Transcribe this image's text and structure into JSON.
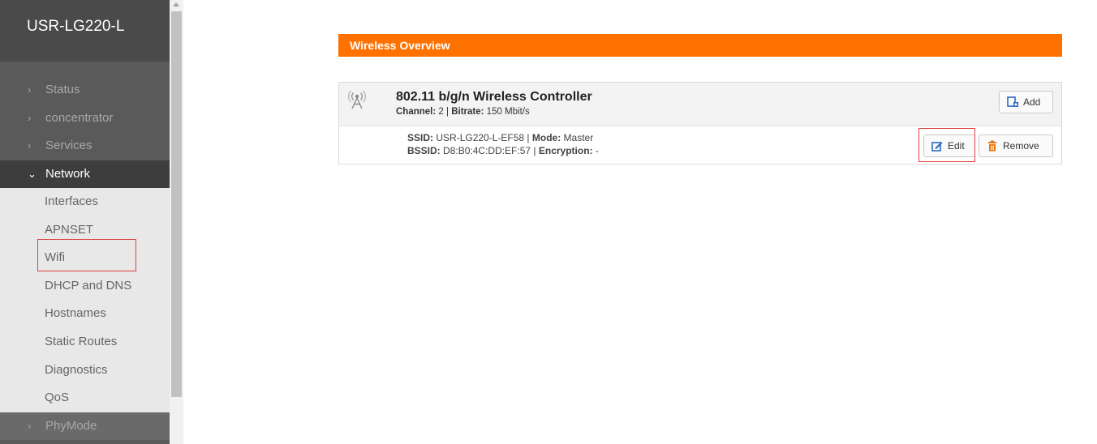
{
  "app": {
    "title": "USR-LG220-L"
  },
  "sidebar": {
    "menu": [
      {
        "label": "Status"
      },
      {
        "label": "concentrator"
      },
      {
        "label": "Services"
      }
    ],
    "network": {
      "label": "Network",
      "submenu": [
        {
          "label": "Interfaces"
        },
        {
          "label": "APNSET"
        },
        {
          "label": "Wifi"
        },
        {
          "label": "DHCP and DNS"
        },
        {
          "label": "Hostnames"
        },
        {
          "label": "Static Routes"
        },
        {
          "label": "Diagnostics"
        },
        {
          "label": "QoS"
        }
      ]
    },
    "phymode": {
      "label": "PhyMode"
    }
  },
  "main": {
    "section_title": "Wireless Overview",
    "controller": {
      "title": "802.11 b/g/n Wireless Controller",
      "channel_label": "Channel:",
      "channel_value": "2",
      "bitrate_label": "Bitrate:",
      "bitrate_value": "150 Mbit/s",
      "add_label": "Add"
    },
    "network": {
      "ssid_label": "SSID:",
      "ssid_value": "USR-LG220-L-EF58",
      "mode_label": "Mode:",
      "mode_value": "Master",
      "bssid_label": "BSSID:",
      "bssid_value": "D8:B0:4C:DD:EF:57",
      "encryption_label": "Encryption:",
      "encryption_value": "-",
      "edit_label": "Edit",
      "remove_label": "Remove"
    }
  },
  "colors": {
    "accent": "#ff7200",
    "sidebar_bg": "#5a5a5a",
    "active_bg": "#3d3d3d",
    "highlight": "#e04040"
  }
}
